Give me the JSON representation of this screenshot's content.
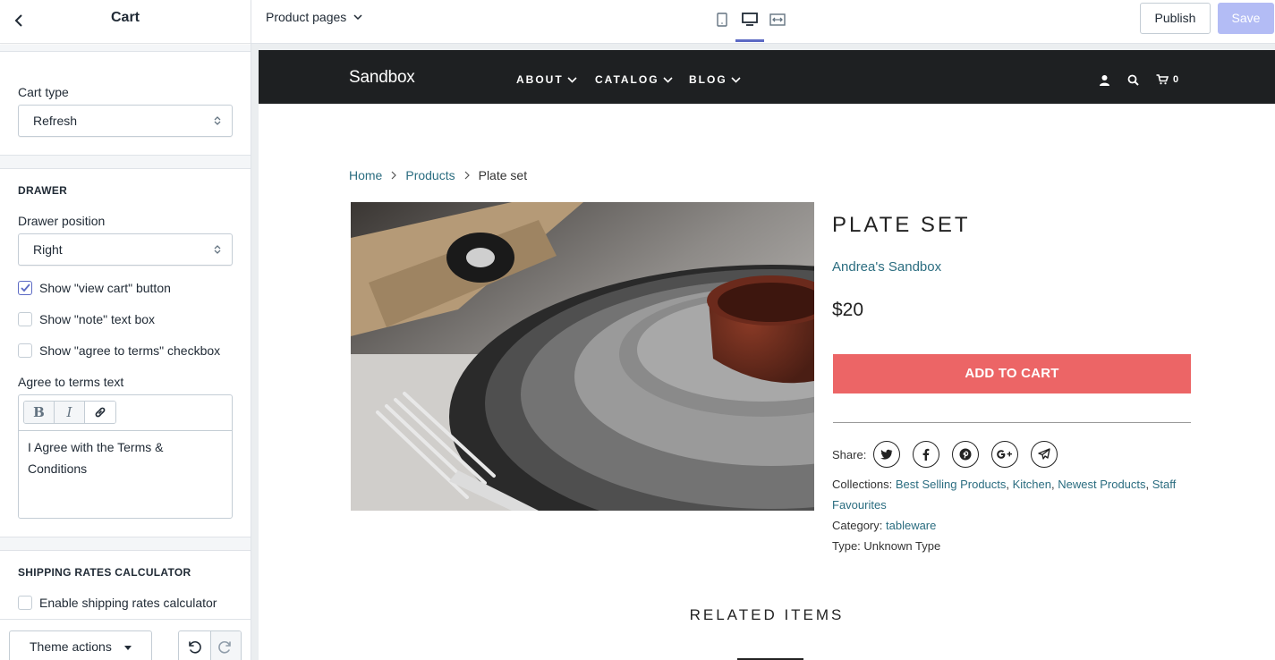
{
  "sidebar": {
    "title": "Cart",
    "cart_type": {
      "label": "Cart type",
      "value": "Refresh"
    },
    "drawer": {
      "heading": "DRAWER",
      "position_label": "Drawer position",
      "position_value": "Right",
      "checkboxes": [
        {
          "label": "Show \"view cart\" button",
          "checked": true
        },
        {
          "label": "Show \"note\" text box",
          "checked": false
        },
        {
          "label": "Show \"agree to terms\" checkbox",
          "checked": false
        }
      ],
      "terms_label": "Agree to terms text",
      "terms_toolbar": [
        "B",
        "I",
        "link-icon"
      ],
      "terms_text": "I Agree with the Terms & Conditions"
    },
    "shipping": {
      "heading": "SHIPPING RATES CALCULATOR",
      "enable_label": "Enable shipping rates calculator",
      "enable_checked": false
    },
    "footer": {
      "theme_actions": "Theme actions"
    }
  },
  "topbar": {
    "page_picker": "Product pages",
    "devices": [
      "mobile-icon",
      "desktop-icon",
      "fullscreen-icon"
    ],
    "active_device": "desktop",
    "publish": "Publish",
    "save": "Save",
    "accent": "#5c6ac4"
  },
  "site": {
    "logo": "Sandbox",
    "nav": [
      "ABOUT",
      "CATALOG",
      "BLOG"
    ],
    "cart_count": "0",
    "breadcrumb": {
      "home": "Home",
      "products": "Products",
      "current": "Plate set"
    },
    "product": {
      "title": "PLATE SET",
      "vendor": "Andrea's Sandbox",
      "price": "$20",
      "add_to_cart": "ADD TO CART",
      "share_label": "Share:",
      "share_icons": [
        "twitter-icon",
        "facebook-icon",
        "pinterest-icon",
        "google-plus-icon",
        "telegram-icon"
      ],
      "collections_label": "Collections:",
      "collections": [
        "Best Selling Products",
        "Kitchen",
        "Newest Products",
        "Staff Favourites"
      ],
      "category_label": "Category:",
      "category": "tableware",
      "type_label": "Type:",
      "type": "Unknown Type"
    },
    "related": "RELATED ITEMS",
    "colors": {
      "nav_bg": "#1e2022",
      "link": "#2b6d80",
      "cta": "#ec6566"
    }
  }
}
